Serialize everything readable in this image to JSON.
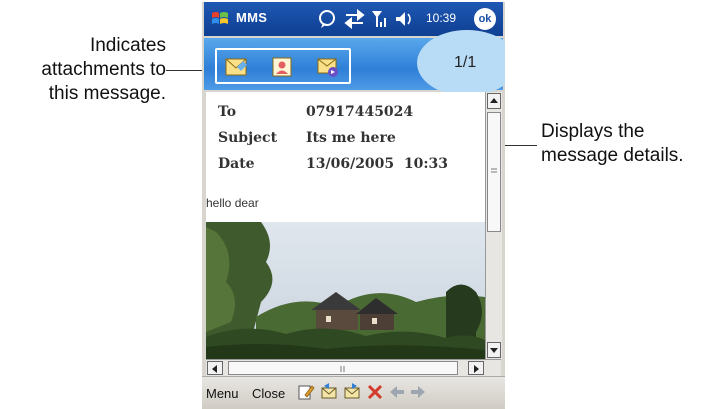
{
  "callouts": {
    "attachments": [
      "Indicates",
      "attachments to",
      "this message."
    ],
    "details": [
      "Displays the",
      "message details."
    ]
  },
  "statusbar": {
    "app_title": "MMS",
    "time": "10:39",
    "ok_label": "ok",
    "icons": [
      "start-icon",
      "notification-icon",
      "sync-icon",
      "signal-icon",
      "volume-icon",
      "ok-icon"
    ]
  },
  "attachments": {
    "page_indicator": "1/1",
    "items": [
      "image-attachment-icon",
      "contact-attachment-icon",
      "audio-attachment-icon"
    ]
  },
  "message": {
    "to_label": "To",
    "to_value": "07917445024",
    "subject_label": "Subject",
    "subject_value": "Its me here",
    "date_label": "Date",
    "date_value": "13/06/2005  10:33",
    "body": "hello dear"
  },
  "menubar": {
    "menu_label": "Menu",
    "close_label": "Close",
    "icons": [
      "edit-icon",
      "reply-icon",
      "forward-icon",
      "delete-icon",
      "previous-icon",
      "next-icon"
    ]
  },
  "colors": {
    "statusbar": "#1a4fa6",
    "attach_bar": "#3f8ee0",
    "menubar": "#dcd9d2",
    "delete": "#d43a2a"
  }
}
